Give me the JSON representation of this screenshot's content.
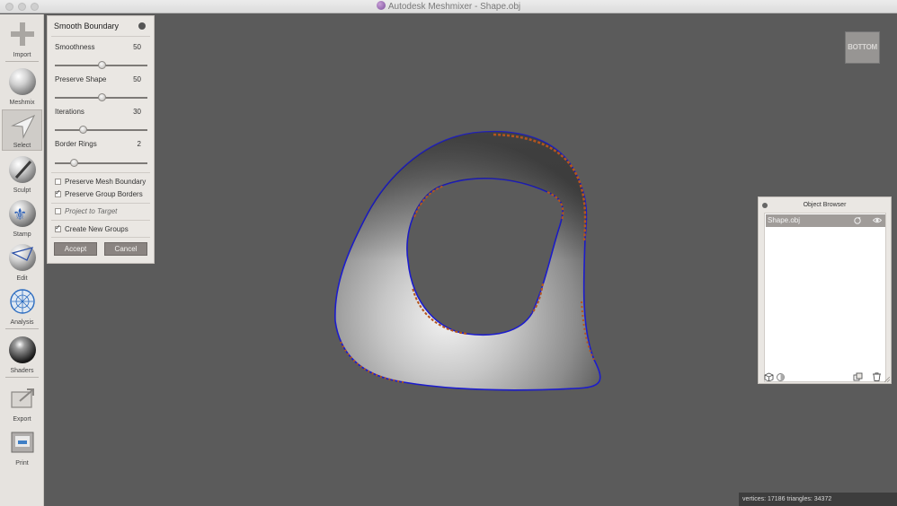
{
  "window": {
    "title": "Autodesk Meshmixer - Shape.obj"
  },
  "toolbar": {
    "items": [
      {
        "label": "Import",
        "icon": "plus-icon"
      },
      {
        "label": "Meshmix",
        "icon": "meshmix-icon"
      },
      {
        "label": "Select",
        "icon": "select-arrow-icon",
        "active": true
      },
      {
        "label": "Sculpt",
        "icon": "brush-icon"
      },
      {
        "label": "Stamp",
        "icon": "stamp-icon"
      },
      {
        "label": "Edit",
        "icon": "edit-icon"
      },
      {
        "label": "Analysis",
        "icon": "analysis-icon"
      },
      {
        "label": "Shaders",
        "icon": "shaders-icon"
      },
      {
        "label": "Export",
        "icon": "export-icon"
      },
      {
        "label": "Print",
        "icon": "print-icon"
      }
    ]
  },
  "panel": {
    "title": "Smooth Boundary",
    "sliders": [
      {
        "label": "Smoothness",
        "value": "50",
        "fraction": 0.5
      },
      {
        "label": "Preserve Shape",
        "value": "50",
        "fraction": 0.5
      },
      {
        "label": "Iterations",
        "value": "30",
        "fraction": 0.3
      },
      {
        "label": "Border Rings",
        "value": "2",
        "fraction": 0.2
      }
    ],
    "checkboxes": [
      {
        "label": "Preserve Mesh Boundary",
        "checked": false
      },
      {
        "label": "Preserve Group Borders",
        "checked": true
      },
      {
        "label": "Project to Target",
        "checked": false,
        "disabled": true
      },
      {
        "label": "Create New Groups",
        "checked": true
      }
    ],
    "accept_label": "Accept",
    "cancel_label": "Cancel"
  },
  "viewcube": {
    "label": "BOTTOM"
  },
  "object_browser": {
    "title": "Object Browser",
    "objects": [
      {
        "name": "Shape.obj"
      }
    ]
  },
  "status": {
    "text": "vertices: 17186  triangles: 34372"
  },
  "colors": {
    "viewport": "#5b5b5b",
    "boundary": "#1c1ccc",
    "boundary_orange": "#b4551e",
    "panel": "#eae7e3",
    "button": "#8a8481"
  }
}
